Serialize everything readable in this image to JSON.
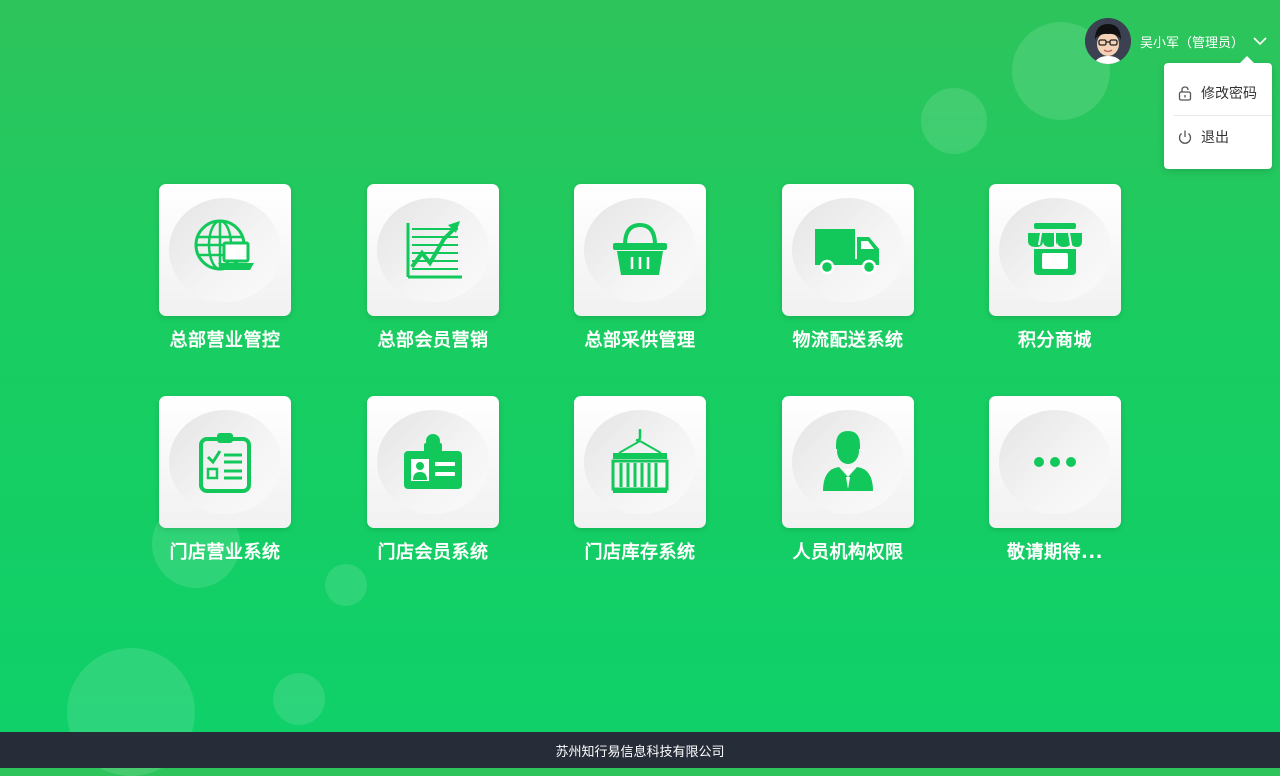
{
  "header": {
    "username": "吴小军（管理员）"
  },
  "dropdown": {
    "items": [
      {
        "label": "修改密码",
        "icon": "lock-icon"
      },
      {
        "label": "退出",
        "icon": "power-icon"
      }
    ]
  },
  "apps": [
    {
      "label": "总部营业管控",
      "icon": "globe-laptop-icon"
    },
    {
      "label": "总部会员营销",
      "icon": "growth-chart-icon"
    },
    {
      "label": "总部采供管理",
      "icon": "basket-icon"
    },
    {
      "label": "物流配送系统",
      "icon": "truck-icon"
    },
    {
      "label": "积分商城",
      "icon": "store-icon"
    },
    {
      "label": "门店营业系统",
      "icon": "checklist-clipboard-icon"
    },
    {
      "label": "门店会员系统",
      "icon": "id-badge-icon"
    },
    {
      "label": "门店库存系统",
      "icon": "container-crane-icon"
    },
    {
      "label": "人员机构权限",
      "icon": "person-icon"
    },
    {
      "label": "敬请期待...",
      "icon": "more-dots-icon"
    }
  ],
  "footer": {
    "company": "苏州知行易信息科技有限公司"
  },
  "colors": {
    "accent": "#12c85a",
    "footer_bg": "#262c38"
  }
}
